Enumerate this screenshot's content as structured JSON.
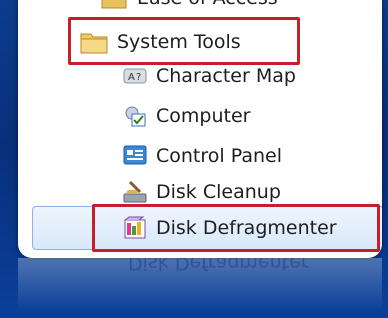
{
  "menu": {
    "partial_top_item": "Ease of Access",
    "parent_folder": "System Tools",
    "items": [
      {
        "label": "Character Map",
        "icon": "character-map-icon"
      },
      {
        "label": "Computer",
        "icon": "computer-icon"
      },
      {
        "label": "Control Panel",
        "icon": "control-panel-icon"
      },
      {
        "label": "Disk Cleanup",
        "icon": "disk-cleanup-icon"
      },
      {
        "label": "Disk Defragmenter",
        "icon": "disk-defragmenter-icon",
        "selected": true
      }
    ],
    "reflection_text": "Disk Defragmenter"
  },
  "colors": {
    "background": "#0d3c8e",
    "highlight_box": "#c4202a",
    "selection": "#d8e9fb"
  }
}
